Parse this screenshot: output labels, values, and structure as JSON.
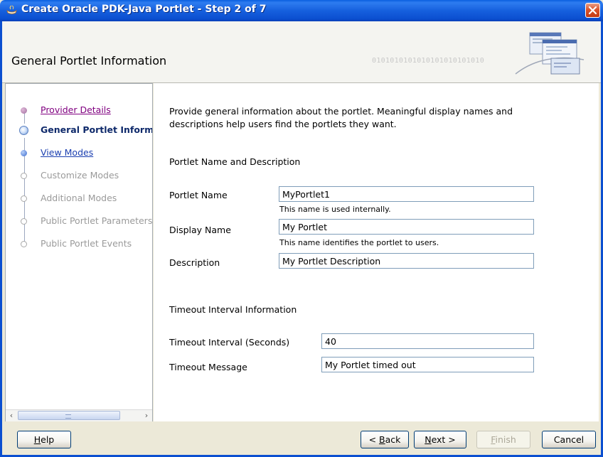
{
  "window": {
    "title": "Create Oracle PDK-Java Portlet - Step 2 of 7"
  },
  "header": {
    "page_title": "General Portlet Information",
    "binary_decoration": "0101010101010101010101010"
  },
  "nav": {
    "items": [
      {
        "label": "Provider Details",
        "state": "visited"
      },
      {
        "label": "General Portlet Information",
        "state": "current"
      },
      {
        "label": "View Modes",
        "state": "enabled"
      },
      {
        "label": "Customize Modes",
        "state": "disabled"
      },
      {
        "label": "Additional Modes",
        "state": "disabled"
      },
      {
        "label": "Public Portlet Parameters",
        "state": "disabled"
      },
      {
        "label": "Public Portlet Events",
        "state": "disabled"
      }
    ]
  },
  "content": {
    "intro": "Provide general information about the portlet. Meaningful display names and descriptions help users find the portlets they want.",
    "name_section": {
      "title": "Portlet Name and Description",
      "portlet_name_label": "Portlet Name",
      "portlet_name_value": "MyPortlet1",
      "portlet_name_hint": "This name is used internally.",
      "display_name_label": "Display Name",
      "display_name_value": "My Portlet",
      "display_name_hint": "This name identifies the portlet to users.",
      "description_label": "Description",
      "description_value": "My Portlet Description"
    },
    "timeout_section": {
      "title": "Timeout Interval Information",
      "interval_label": "Timeout Interval (Seconds)",
      "interval_value": "40",
      "message_label": "Timeout Message",
      "message_value": "My Portlet timed out"
    }
  },
  "footer": {
    "help": {
      "mnemonic": "H",
      "rest": "elp"
    },
    "back": {
      "prefix": "< ",
      "mnemonic": "B",
      "rest": "ack"
    },
    "next": {
      "mnemonic": "N",
      "rest": "ext >"
    },
    "finish": {
      "mnemonic": "F",
      "rest": "inish"
    },
    "cancel": "Cancel"
  },
  "colors": {
    "titlebar": "#0B4FD0",
    "visited_link": "#800080",
    "current_step": "#0F2A6B",
    "link": "#1B3FB0",
    "disabled_text": "#9A9A9A"
  }
}
